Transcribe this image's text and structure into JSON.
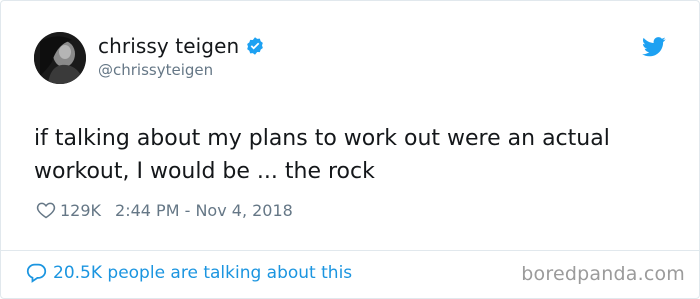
{
  "author": {
    "display_name": "chrissy teigen",
    "handle": "@chrissyteigen"
  },
  "tweet": {
    "text": "if talking about my plans to work out were an actual workout, I would be ... the rock",
    "likes": "129K",
    "timestamp": "2:44 PM - Nov 4, 2018"
  },
  "conversation": {
    "label": "20.5K people are talking about this"
  },
  "watermark": "boredpanda.com",
  "icons": {
    "verified": "verified-badge-icon",
    "platform": "twitter-bird-icon",
    "like": "heart-icon",
    "reply": "speech-bubble-icon"
  },
  "colors": {
    "accent": "#1b95e0",
    "verified": "#1da1f2",
    "secondary_text": "#657786",
    "border": "#e1e8ed"
  }
}
